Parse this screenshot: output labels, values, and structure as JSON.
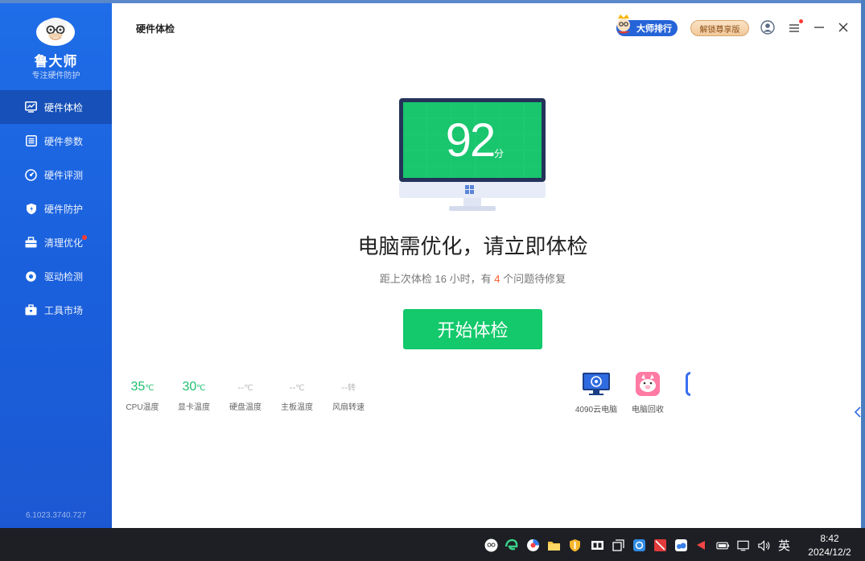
{
  "sidebar": {
    "brand": "鲁大师",
    "slogan": "专注硬件防护",
    "version": "6.1023.3740.727",
    "items": [
      {
        "label": "硬件体检",
        "icon": "monitor-chart-icon",
        "active": true
      },
      {
        "label": "硬件参数",
        "icon": "list-icon"
      },
      {
        "label": "硬件评测",
        "icon": "gauge-icon"
      },
      {
        "label": "硬件防护",
        "icon": "shield-icon"
      },
      {
        "label": "清理优化",
        "icon": "toolbox-icon",
        "badge": true
      },
      {
        "label": "驱动检测",
        "icon": "gear-icon"
      },
      {
        "label": "工具市场",
        "icon": "briefcase-icon"
      }
    ]
  },
  "header": {
    "title": "硬件体检",
    "rank_label": "大师排行",
    "vip_label": "解锁尊享版"
  },
  "main": {
    "score": "92",
    "score_unit": "分",
    "headline": "电脑需优化，请立即体检",
    "subline_prefix": "距上次体检 16 小时，有 ",
    "issue_count": "4",
    "subline_suffix": " 个问题待修复",
    "start_button": "开始体检"
  },
  "stats": [
    {
      "value": "35",
      "unit": "℃",
      "label": "CPU温度"
    },
    {
      "value": "30",
      "unit": "℃",
      "label": "显卡温度"
    },
    {
      "value": "--",
      "unit": "℃",
      "label": "硬盘温度"
    },
    {
      "value": "--",
      "unit": "℃",
      "label": "主板温度"
    },
    {
      "value": "--",
      "unit": "转",
      "label": "风扇转速"
    }
  ],
  "tools": [
    {
      "label": "4090云电脑",
      "icon": "cloud-pc-icon"
    },
    {
      "label": "电脑回收",
      "icon": "piggy-icon"
    }
  ],
  "taskbar": {
    "lang": "英",
    "time": "8:42",
    "date": "2024/12/2"
  },
  "colors": {
    "sidebar": "#1f6de8",
    "accent_green": "#13c96b",
    "warn": "#ff5a2a"
  }
}
